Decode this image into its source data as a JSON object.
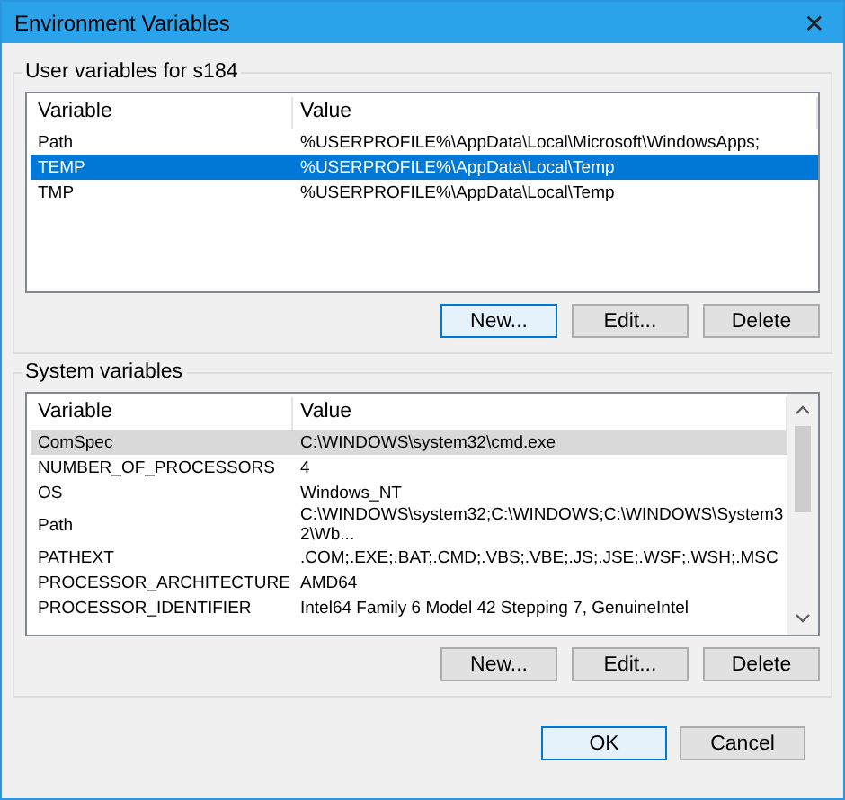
{
  "window": {
    "title": "Environment Variables",
    "close": "✕"
  },
  "groups": [
    {
      "label": "User variables for s184",
      "focused": true,
      "scrollbar": false,
      "columns": [
        "Variable",
        "Value"
      ],
      "rows": [
        {
          "variable": "Path",
          "value": "%USERPROFILE%\\AppData\\Local\\Microsoft\\WindowsApps;",
          "selected": false
        },
        {
          "variable": "TEMP",
          "value": "%USERPROFILE%\\AppData\\Local\\Temp",
          "selected": true
        },
        {
          "variable": "TMP",
          "value": "%USERPROFILE%\\AppData\\Local\\Temp",
          "selected": false
        }
      ],
      "buttons": [
        {
          "label": "New...",
          "focused": true
        },
        {
          "label": "Edit...",
          "focused": false
        },
        {
          "label": "Delete",
          "focused": false
        }
      ]
    },
    {
      "label": "System variables",
      "focused": false,
      "scrollbar": true,
      "columns": [
        "Variable",
        "Value"
      ],
      "rows": [
        {
          "variable": "ComSpec",
          "value": "C:\\WINDOWS\\system32\\cmd.exe",
          "selected": true
        },
        {
          "variable": "NUMBER_OF_PROCESSORS",
          "value": "4",
          "selected": false
        },
        {
          "variable": "OS",
          "value": "Windows_NT",
          "selected": false
        },
        {
          "variable": "Path",
          "value": "C:\\WINDOWS\\system32;C:\\WINDOWS;C:\\WINDOWS\\System32\\Wb...",
          "selected": false
        },
        {
          "variable": "PATHEXT",
          "value": ".COM;.EXE;.BAT;.CMD;.VBS;.VBE;.JS;.JSE;.WSF;.WSH;.MSC",
          "selected": false
        },
        {
          "variable": "PROCESSOR_ARCHITECTURE",
          "value": "AMD64",
          "selected": false
        },
        {
          "variable": "PROCESSOR_IDENTIFIER",
          "value": "Intel64 Family 6 Model 42 Stepping 7, GenuineIntel",
          "selected": false
        }
      ],
      "buttons": [
        {
          "label": "New...",
          "focused": false
        },
        {
          "label": "Edit...",
          "focused": false
        },
        {
          "label": "Delete",
          "focused": false
        }
      ]
    }
  ],
  "footer": [
    {
      "label": "OK",
      "focused": true
    },
    {
      "label": "Cancel",
      "focused": false
    }
  ]
}
